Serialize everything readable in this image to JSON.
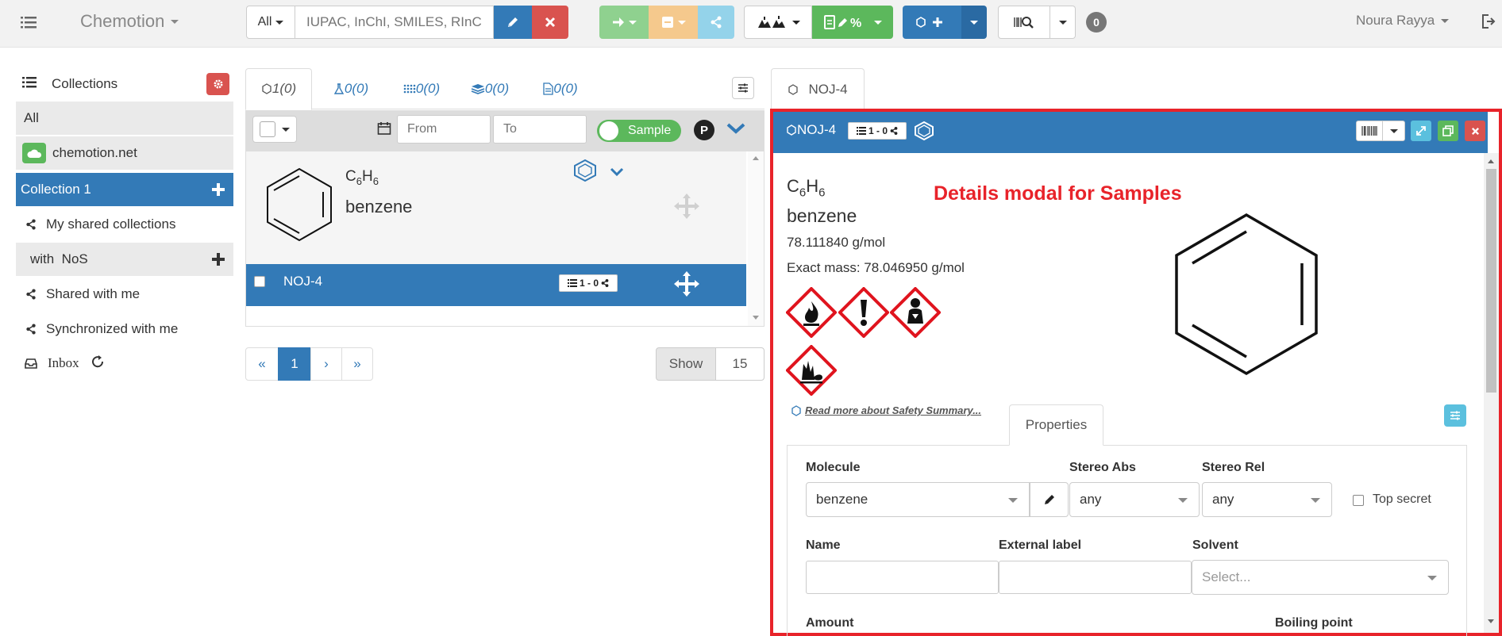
{
  "navbar": {
    "app_title": "Chemotion",
    "search_scope": "All",
    "search_placeholder": "IUPAC, InChI, SMILES, RInChI",
    "notification_count": "0",
    "user_name": "Noura Rayya"
  },
  "sidebar": {
    "collections_label": "Collections",
    "items": [
      {
        "label": "All"
      },
      {
        "label": "chemotion.net"
      },
      {
        "label": "Collection 1"
      },
      {
        "label": "My shared collections"
      },
      {
        "label": "with  NoS"
      },
      {
        "label": "Shared with me"
      },
      {
        "label": "Synchronized with me"
      },
      {
        "label": "Inbox"
      }
    ]
  },
  "list_panel": {
    "tabs": [
      {
        "icon": "sample-icon",
        "label": "1(0)"
      },
      {
        "icon": "reaction-icon",
        "label": "0(0)"
      },
      {
        "icon": "wellplate-icon",
        "label": "0(0)"
      },
      {
        "icon": "screen-icon",
        "label": "0(0)"
      },
      {
        "icon": "research-plan-icon",
        "label": "0(0)"
      }
    ],
    "date_from_placeholder": "From",
    "date_to_placeholder": "To",
    "toggle_label": "Sample",
    "p_badge": "P",
    "molecule_formula": {
      "base1": "C",
      "sub1": "6",
      "base2": "H",
      "sub2": "6"
    },
    "molecule_name": "benzene",
    "sample_row_label": "NOJ-4",
    "sample_row_badge": "1 - 0",
    "pagination": {
      "first": "«",
      "page": "1",
      "next": "›",
      "last": "»"
    },
    "show_label": "Show",
    "show_value": "15"
  },
  "detail": {
    "tab_label": "NOJ-4",
    "header_title": "NOJ-4",
    "header_badge": "1 - 0",
    "formula": {
      "base1": "C",
      "sub1": "6",
      "base2": "H",
      "sub2": "6"
    },
    "name": "benzene",
    "molar_mass": "78.111840 g/mol",
    "exact_mass": "Exact mass: 78.046950 g/mol",
    "annotation": "Details modal for Samples",
    "annotation_color": "#e8232a",
    "safety_link": "Read more about Safety Summary...",
    "properties_tab": "Properties",
    "fields": {
      "molecule_label": "Molecule",
      "molecule_value": "benzene",
      "stereo_abs_label": "Stereo Abs",
      "stereo_abs_value": "any",
      "stereo_rel_label": "Stereo Rel",
      "stereo_rel_value": "any",
      "top_secret_label": "Top secret",
      "name_label": "Name",
      "external_label_label": "External label",
      "solvent_label": "Solvent",
      "solvent_placeholder": "Select...",
      "amount_label": "Amount",
      "boiling_point_label": "Boiling point"
    },
    "ghs_pictograms": [
      "flame-icon",
      "exclamation-icon",
      "health-hazard-icon",
      "environment-icon"
    ]
  },
  "colors": {
    "primary": "#337ab7",
    "danger": "#d9534f",
    "success": "#5cb85c",
    "info": "#5bc0de",
    "warning": "#f0ad4e",
    "highlight_border": "#e8232a"
  }
}
